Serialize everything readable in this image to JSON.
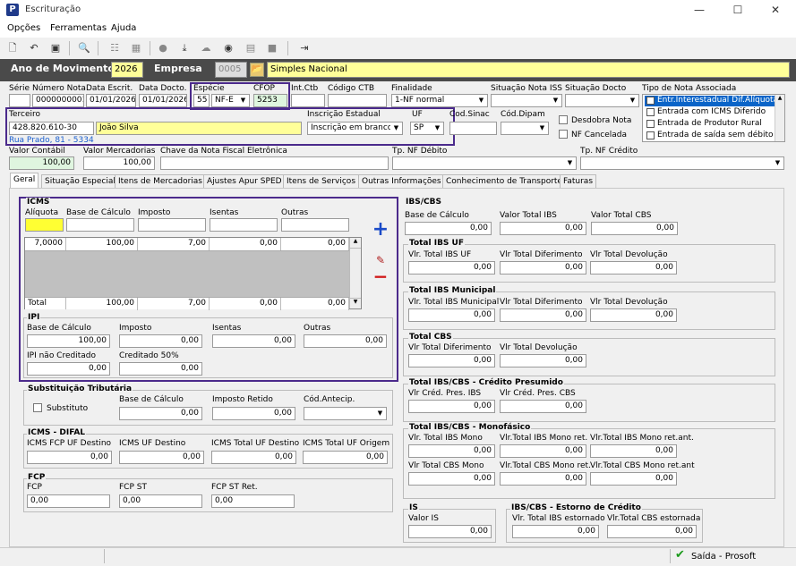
{
  "window": {
    "title": "Escrituração",
    "app_icon": "P",
    "min": "—",
    "max": "☐",
    "close": "✕"
  },
  "menu": [
    "Opções",
    "Ferramentas",
    "Ajuda"
  ],
  "header": {
    "ano_label": "Ano de Movimento",
    "ano_value": "2026",
    "empresa_label": "Empresa",
    "empresa_code": "0005",
    "empresa_name": "Simples Nacional"
  },
  "doc": {
    "serie_label": "Série",
    "serie": "",
    "numero_label": "Número Nota",
    "numero": "0000000001",
    "data_escrit_label": "Data Escrit.",
    "data_escrit": "01/01/2026",
    "data_docto_label": "Data Docto.",
    "data_docto": "01/01/2026",
    "especie_label": "Espécie",
    "especie_code": "55",
    "especie_value": "NF-E",
    "cfop_label": "CFOP",
    "cfop": "5253",
    "intctb_label": "Int.Ctb",
    "intctb": "",
    "codctb_label": "Código CTB",
    "codctb": "",
    "finalidade_label": "Finalidade",
    "finalidade": "1-NF normal",
    "sit_iss_label": "Situação Nota ISS",
    "sit_iss": "",
    "sit_docto_label": "Situação Docto",
    "sit_docto": "",
    "tipo_nota_label": "Tipo de Nota Associada",
    "tipo_nota_items": [
      "Entr.Interestadual Dif.Alíquota",
      "Entrada com ICMS Diferido",
      "Entrada de Produtor Rural",
      "Entrada de saída sem débito"
    ],
    "terceiro_label": "Terceiro",
    "terceiro_code": "428.820.610-30",
    "terceiro_name": "João Silva",
    "terceiro_address": "Rua Prado, 81 - 5334",
    "ie_label": "Inscrição Estadual",
    "ie_value": "Inscrição em branco",
    "uf_label": "UF",
    "uf_value": "SP",
    "codsinac_label": "Cod.Sinac",
    "coddipam_label": "Cód.Dipam",
    "desdobra_label": "Desdobra Nota",
    "cancelada_label": "NF Cancelada",
    "valor_contabil_label": "Valor Contábil",
    "valor_contabil": "100,00",
    "valor_merc_label": "Valor Mercadorias",
    "valor_merc": "100,00",
    "chave_label": "Chave da Nota Fiscal Eletrônica",
    "chave": "",
    "tp_debito_label": "Tp. NF Débito",
    "tp_credito_label": "Tp. NF Crédito"
  },
  "tabs": [
    "Geral",
    "Situação Especial",
    "Itens de Mercadorias",
    "Ajustes Apur SPED",
    "Itens de Serviços",
    "Outras Informações",
    "Conhecimento de Transporte",
    "Faturas"
  ],
  "icms": {
    "title": "ICMS",
    "headers": [
      "Alíquota",
      "Base de Cálculo",
      "Imposto",
      "Isentas",
      "Outras"
    ],
    "row": [
      "7,0000",
      "100,00",
      "7,00",
      "0,00",
      "0,00"
    ],
    "total_label": "Total",
    "total": [
      "100,00",
      "7,00",
      "0,00",
      "0,00"
    ],
    "add": "+",
    "edit": "✎",
    "remove": "−"
  },
  "ipi": {
    "title": "IPI",
    "base_label": "Base de Cálculo",
    "base": "100,00",
    "imposto_label": "Imposto",
    "imposto": "0,00",
    "isentas_label": "Isentas",
    "isentas": "0,00",
    "outras_label": "Outras",
    "outras": "0,00",
    "nao_cred_label": "IPI não Creditado",
    "nao_cred": "0,00",
    "cred50_label": "Creditado 50%",
    "cred50": "0,00"
  },
  "st": {
    "title": "Substituição Tributária",
    "substituto_label": "Substituto",
    "base_label": "Base de Cálculo",
    "base": "0,00",
    "retido_label": "Imposto Retido",
    "retido": "0,00",
    "antecip_label": "Cód.Antecip.",
    "antecip": ""
  },
  "difal": {
    "title": "ICMS - DIFAL",
    "labels": [
      "ICMS FCP UF Destino",
      "ICMS UF Destino",
      "ICMS Total UF Destino",
      "ICMS Total UF Origem"
    ],
    "values": [
      "0,00",
      "0,00",
      "0,00",
      "0,00"
    ]
  },
  "fcp": {
    "title": "FCP",
    "labels": [
      "FCP",
      "FCP ST",
      "FCP ST Ret."
    ],
    "values": [
      "0,00",
      "0,00",
      "0,00"
    ]
  },
  "ibscbs": {
    "title": "IBS/CBS",
    "labels": [
      "Base de Cálculo",
      "Valor Total IBS",
      "Valor Total CBS"
    ],
    "values": [
      "0,00",
      "0,00",
      "0,00"
    ],
    "uf_title": "Total IBS UF",
    "uf_labels": [
      "Vlr. Total IBS UF",
      "Vlr Total Diferimento",
      "Vlr Total Devolução"
    ],
    "uf_values": [
      "0,00",
      "0,00",
      "0,00"
    ],
    "mun_title": "Total IBS Municipal",
    "mun_labels": [
      "Vlr. Total IBS Municipal",
      "Vlr Total Diferimento",
      "Vlr Total Devolução"
    ],
    "mun_values": [
      "0,00",
      "0,00",
      "0,00"
    ],
    "cbs_title": "Total CBS",
    "cbs_labels": [
      "Vlr Total Diferimento",
      "Vlr Total Devolução"
    ],
    "cbs_values": [
      "0,00",
      "0,00"
    ],
    "pres_title": "Total IBS/CBS - Crédito Presumido",
    "pres_labels": [
      "Vlr Créd. Pres. IBS",
      "Vlr Créd. Pres. CBS"
    ],
    "pres_values": [
      "0,00",
      "0,00"
    ],
    "mono_title": "Total IBS/CBS - Monofásico",
    "mono_labels": [
      "Vlr. Total IBS Mono",
      "Vlr.Total IBS Mono ret.",
      "Vlr.Total IBS Mono ret.ant.",
      "Vlr Total CBS Mono",
      "Vlr.Total CBS Mono ret.",
      "Vlr.Total CBS Mono ret.ant"
    ],
    "mono_values": [
      "0,00",
      "0,00",
      "0,00",
      "0,00",
      "0,00",
      "0,00"
    ]
  },
  "is": {
    "title": "IS",
    "label": "Valor IS",
    "value": "0,00"
  },
  "estorno": {
    "title": "IBS/CBS - Estorno de Crédito",
    "labels": [
      "Vlr. Total IBS estornado",
      "Vlr.Total CBS estornada"
    ],
    "values": [
      "0,00",
      "0,00"
    ]
  },
  "status": {
    "text": "Saída - Prosoft"
  }
}
